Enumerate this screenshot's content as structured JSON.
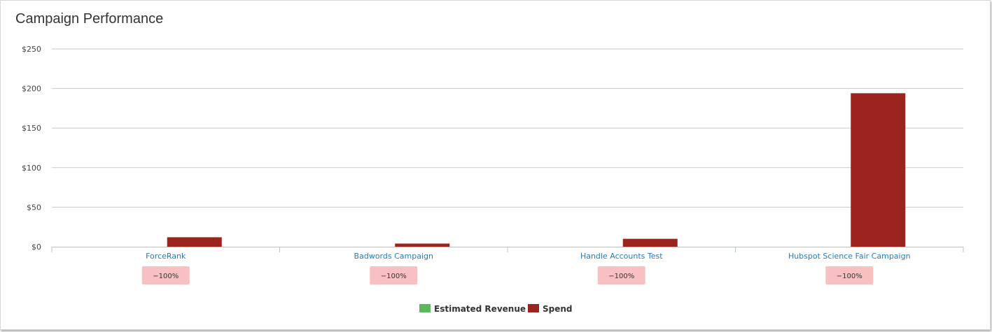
{
  "panel": {
    "title": "Campaign Performance"
  },
  "colors": {
    "revenue": "#5cb85c",
    "spend": "#9b251c",
    "grid": "#c8c8c8",
    "axis": "#b0c4d8",
    "badge_bg": "#f8c0c0",
    "category": "#2a7ab8"
  },
  "chart_data": {
    "type": "bar",
    "categories": [
      "ForceRank",
      "Badwords Campaign",
      "Handle Accounts Test",
      "Hubspot Science Fair Campaign"
    ],
    "series": [
      {
        "name": "Estimated Revenue",
        "values": [
          0,
          0,
          0,
          0
        ]
      },
      {
        "name": "Spend",
        "values": [
          12,
          4,
          10,
          194
        ]
      }
    ],
    "ylim": [
      0,
      250
    ],
    "yticks": [
      0,
      50,
      100,
      150,
      200,
      250
    ],
    "ytick_labels": [
      "$0",
      "$50",
      "$100",
      "$150",
      "$200",
      "$250"
    ],
    "change_badges": [
      "−100%",
      "−100%",
      "−100%",
      "−100%"
    ],
    "grid": true,
    "legend": "bottom-center"
  }
}
